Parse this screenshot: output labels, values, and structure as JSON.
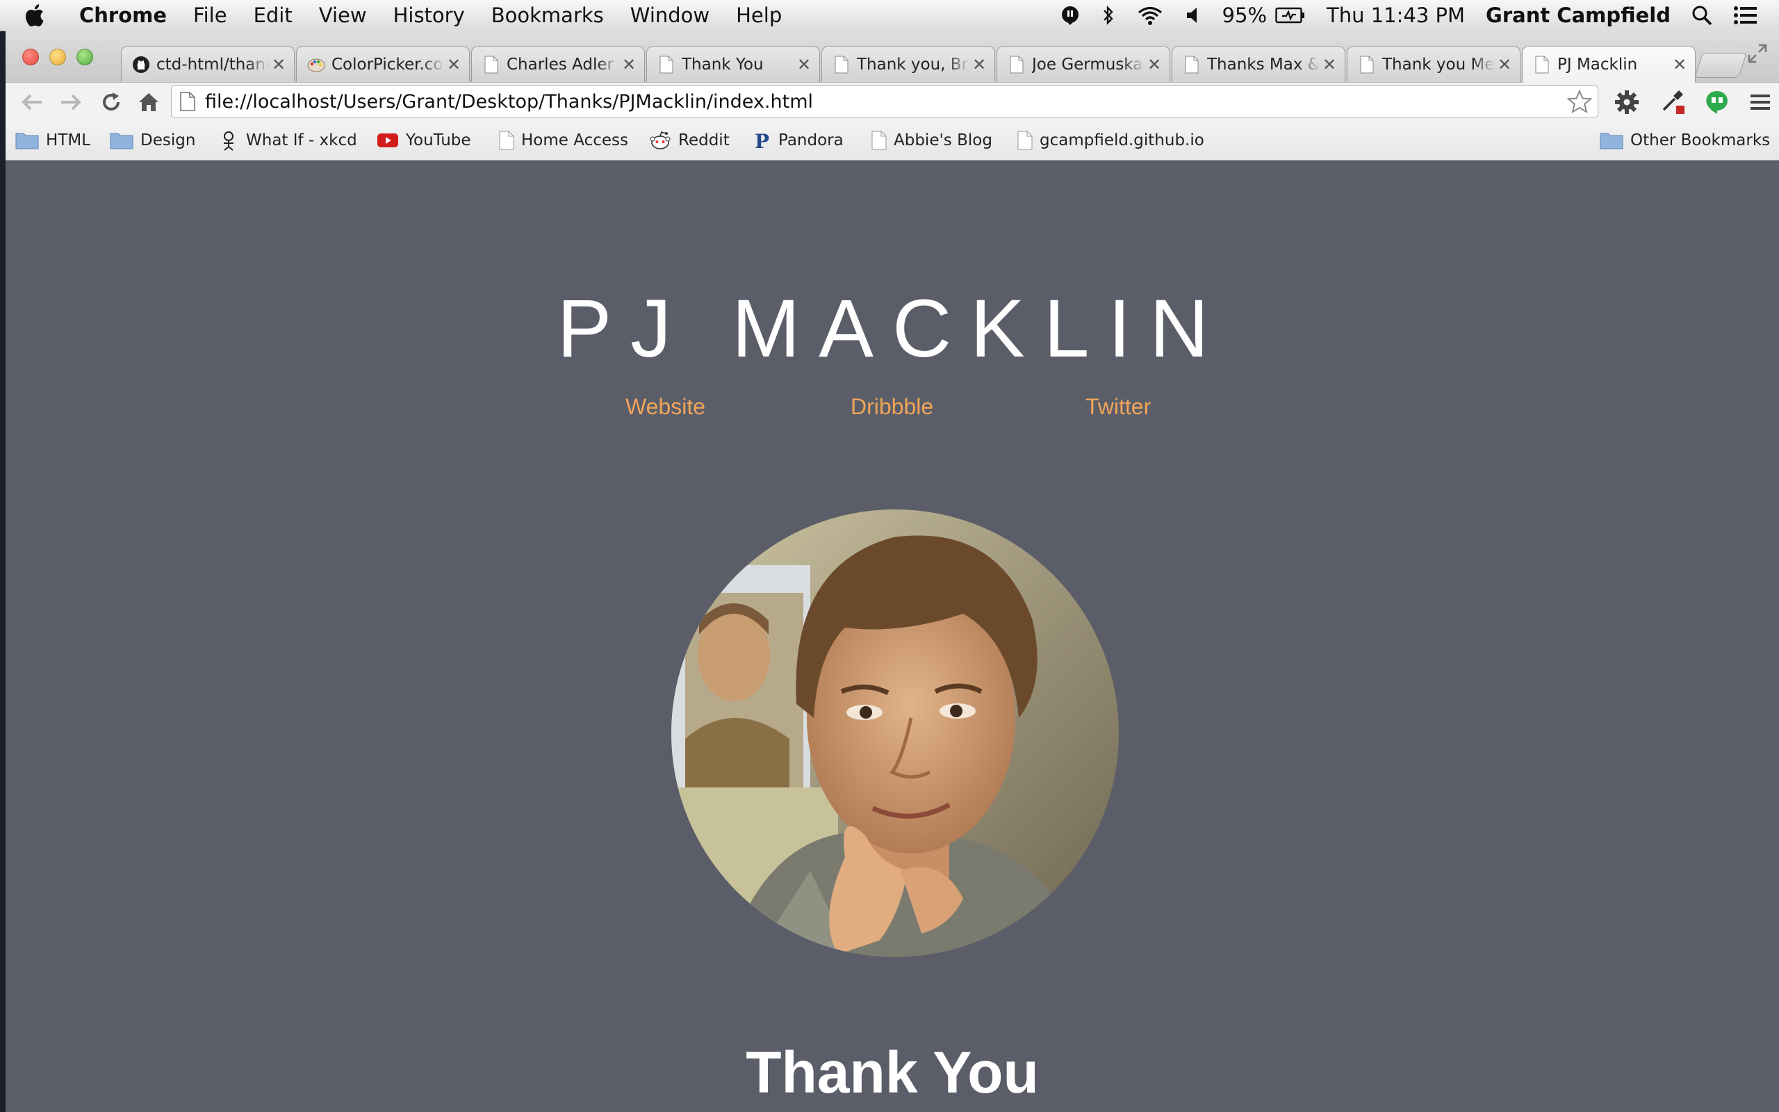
{
  "menubar": {
    "app_name": "Chrome",
    "menus": [
      "File",
      "Edit",
      "View",
      "History",
      "Bookmarks",
      "Window",
      "Help"
    ],
    "battery": "95%",
    "clock": "Thu 11:43 PM",
    "user": "Grant Campfield"
  },
  "tabs": [
    {
      "title": "ctd-html/thanks",
      "icon": "github-icon"
    },
    {
      "title": "ColorPicker.com",
      "icon": "palette-icon"
    },
    {
      "title": "Charles Adler",
      "icon": "document-icon"
    },
    {
      "title": "Thank You",
      "icon": "document-icon"
    },
    {
      "title": "Thank you, Br",
      "icon": "document-icon"
    },
    {
      "title": "Joe Germuska",
      "icon": "document-icon"
    },
    {
      "title": "Thanks Max &",
      "icon": "document-icon"
    },
    {
      "title": "Thank you Me",
      "icon": "document-icon"
    },
    {
      "title": "PJ Macklin",
      "icon": "document-icon",
      "active": true
    }
  ],
  "address_bar": {
    "url": "file://localhost/Users/Grant/Desktop/Thanks/PJMacklin/index.html"
  },
  "bookmarks": [
    {
      "label": "HTML",
      "icon": "folder-icon"
    },
    {
      "label": "Design",
      "icon": "folder-icon"
    },
    {
      "label": "What If - xkcd",
      "icon": "xkcd-icon"
    },
    {
      "label": "YouTube",
      "icon": "youtube-icon"
    },
    {
      "label": "Home Access",
      "icon": "document-icon"
    },
    {
      "label": "Reddit",
      "icon": "reddit-icon"
    },
    {
      "label": "Pandora",
      "icon": "pandora-icon"
    },
    {
      "label": "Abbie's Blog",
      "icon": "document-icon"
    },
    {
      "label": "gcampfield.github.io",
      "icon": "document-icon"
    }
  ],
  "other_bookmarks": "Other Bookmarks",
  "page": {
    "name": "PJ MACKLIN",
    "links": [
      "Website",
      "Dribbble",
      "Twitter"
    ],
    "heading": "Thank You"
  },
  "colors": {
    "page_background": "#5b5e69",
    "link_accent": "#f0a559",
    "heading_text": "#ffffff"
  }
}
